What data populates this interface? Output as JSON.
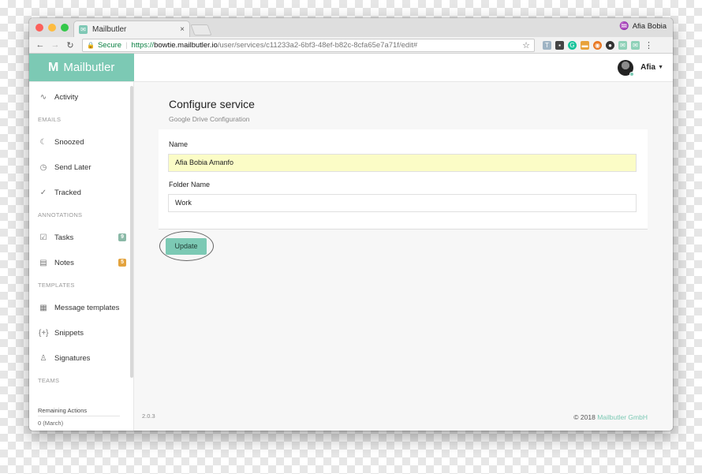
{
  "browser": {
    "tab_title": "Mailbutler",
    "tab_close": "×",
    "profile_name": "Afia Bobia",
    "security_label": "Secure",
    "url_proto": "https://",
    "url_host": "bowtie.mailbutler.io",
    "url_path": "/user/services/c11233a2-6bf3-48ef-b82c-8cfa65e7a71f/edit#"
  },
  "app": {
    "logo_text": "Mailbutler",
    "user_name": "Afia"
  },
  "sidebar": {
    "activity": "Activity",
    "section_emails": "EMAILS",
    "snoozed": "Snoozed",
    "send_later": "Send Later",
    "tracked": "Tracked",
    "section_annotations": "ANNOTATIONS",
    "tasks": "Tasks",
    "tasks_count": "9",
    "notes": "Notes",
    "notes_count": "5",
    "section_templates": "TEMPLATES",
    "message_templates": "Message templates",
    "snippets": "Snippets",
    "signatures": "Signatures",
    "section_teams": "TEAMS",
    "remaining_actions": "Remaining Actions",
    "remaining_value": "0 (March)"
  },
  "main": {
    "title": "Configure service",
    "subtitle": "Google Drive Configuration",
    "name_label": "Name",
    "name_value": "Afia Bobia Amanfo",
    "folder_label": "Folder Name",
    "folder_value": "Work",
    "update_label": "Update"
  },
  "footer": {
    "version": "2.0.3",
    "copyright_prefix": "© 2018",
    "copyright_link": "Mailbutler GmbH"
  },
  "colors": {
    "brand": "#7cc9b4",
    "autofill": "#fbfcc6",
    "badge_green": "#8ab9a7",
    "badge_orange": "#e3a33e"
  }
}
